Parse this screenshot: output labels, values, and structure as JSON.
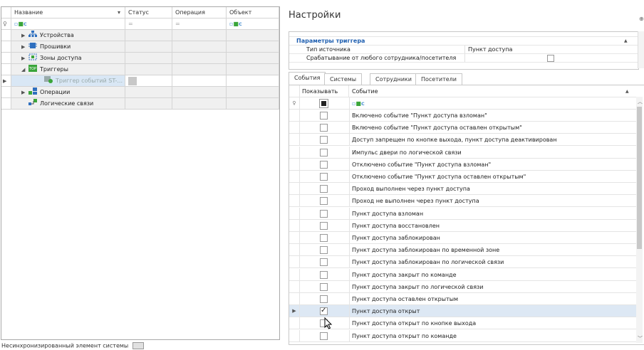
{
  "left_grid": {
    "columns": [
      "Название",
      "Статус",
      "Операция",
      "Объект"
    ],
    "filter_glyph": "=",
    "filter_icon_text": "a",
    "rows": [
      {
        "label": "Устройства",
        "icon": "devices-icon",
        "expand": "▶",
        "indent": 0,
        "grey": true
      },
      {
        "label": "Прошивки",
        "icon": "firmware-icon",
        "expand": "▶",
        "indent": 0,
        "grey": true
      },
      {
        "label": "Зоны доступа",
        "icon": "access-zones-icon",
        "expand": "▶",
        "indent": 0,
        "grey": true
      },
      {
        "label": "Триггеры",
        "icon": "triggers-icon",
        "expand": "◢",
        "indent": 0,
        "grey": true
      },
      {
        "label": "Триггер событий ST-...",
        "icon": "trigger-item-icon",
        "expand": "",
        "indent": 1,
        "selected": true
      },
      {
        "label": "Операции",
        "icon": "operations-icon",
        "expand": "▶",
        "indent": 0,
        "grey": true
      },
      {
        "label": "Логические связи",
        "icon": "logic-links-icon",
        "expand": "",
        "indent": 0,
        "grey": true
      }
    ]
  },
  "legend": {
    "text": "Несинхронизированный элемент системы"
  },
  "settings": {
    "title": "Настройки",
    "trigger_params": {
      "section_title": "Параметры триггера",
      "rows": [
        {
          "name": "Тип источника",
          "value": "Пункт доступа"
        },
        {
          "name": "Срабатывание от любого сотрудника/посетителя",
          "value": ""
        }
      ]
    },
    "tabs": [
      "События",
      "Системы",
      "Сотрудники",
      "Посетители"
    ],
    "events": {
      "col_show": "Показывать",
      "col_event": "Событие",
      "rows": [
        {
          "label": "Включено событие \"Пункт доступа взломан\"",
          "checked": false
        },
        {
          "label": "Включено событие \"Пункт доступа оставлен открытым\"",
          "checked": false
        },
        {
          "label": "Доступ запрещен по кнопке выхода, пункт доступа деактивирован",
          "checked": false
        },
        {
          "label": "Импульс двери по логической связи",
          "checked": false
        },
        {
          "label": "Отключено событие \"Пункт доступа взломан\"",
          "checked": false
        },
        {
          "label": "Отключено событие \"Пункт доступа оставлен открытым\"",
          "checked": false
        },
        {
          "label": "Проход выполнен через пункт доступа",
          "checked": false
        },
        {
          "label": "Проход не выполнен через пункт доступа",
          "checked": false
        },
        {
          "label": "Пункт доступа взломан",
          "checked": false
        },
        {
          "label": "Пункт доступа восстановлен",
          "checked": false
        },
        {
          "label": "Пункт доступа заблокирован",
          "checked": false
        },
        {
          "label": "Пункт доступа заблокирован по временной зоне",
          "checked": false
        },
        {
          "label": "Пункт доступа заблокирован по логической связи",
          "checked": false
        },
        {
          "label": "Пункт доступа закрыт по команде",
          "checked": false
        },
        {
          "label": "Пункт доступа закрыт по логической связи",
          "checked": false
        },
        {
          "label": "Пункт доступа оставлен открытым",
          "checked": false
        },
        {
          "label": "Пункт доступа открыт",
          "checked": true,
          "current": true
        },
        {
          "label": "Пункт доступа открыт по кнопке выхода",
          "checked": false
        },
        {
          "label": "Пункт доступа открыт по команде",
          "checked": false
        }
      ]
    }
  }
}
